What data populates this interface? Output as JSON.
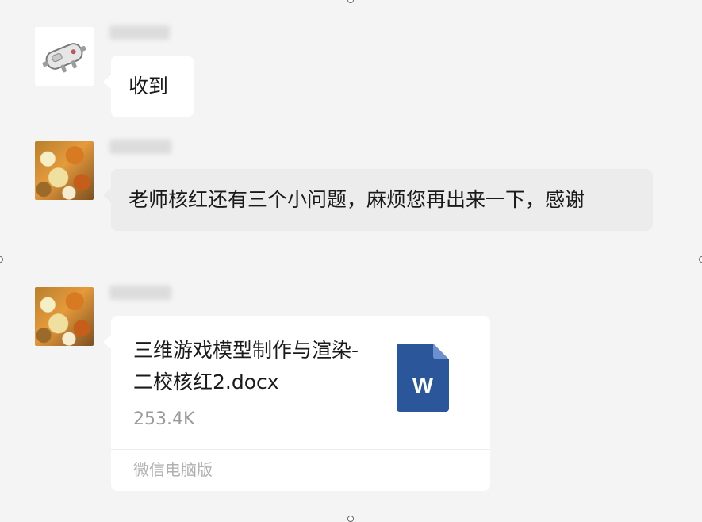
{
  "messages": [
    {
      "sender_name": "",
      "text": "收到",
      "avatar_icon": "robot-avatar"
    },
    {
      "sender_name": "",
      "text": "老师核红还有三个小问题，麻烦您再出来一下，感谢",
      "avatar_icon": "food-photo-avatar"
    },
    {
      "sender_name": "",
      "file": {
        "name": "三维游戏模型制作与渲染-二校核红2.docx",
        "size": "253.4K",
        "icon": "word-document-icon",
        "icon_letter": "W",
        "source": "微信电脑版"
      },
      "avatar_icon": "food-photo-avatar"
    }
  ],
  "colors": {
    "background": "#f4f4f4",
    "bubble_white": "#ffffff",
    "bubble_gray": "#ececec",
    "word_blue": "#2b579a",
    "secondary_text": "#9a9a9a"
  }
}
